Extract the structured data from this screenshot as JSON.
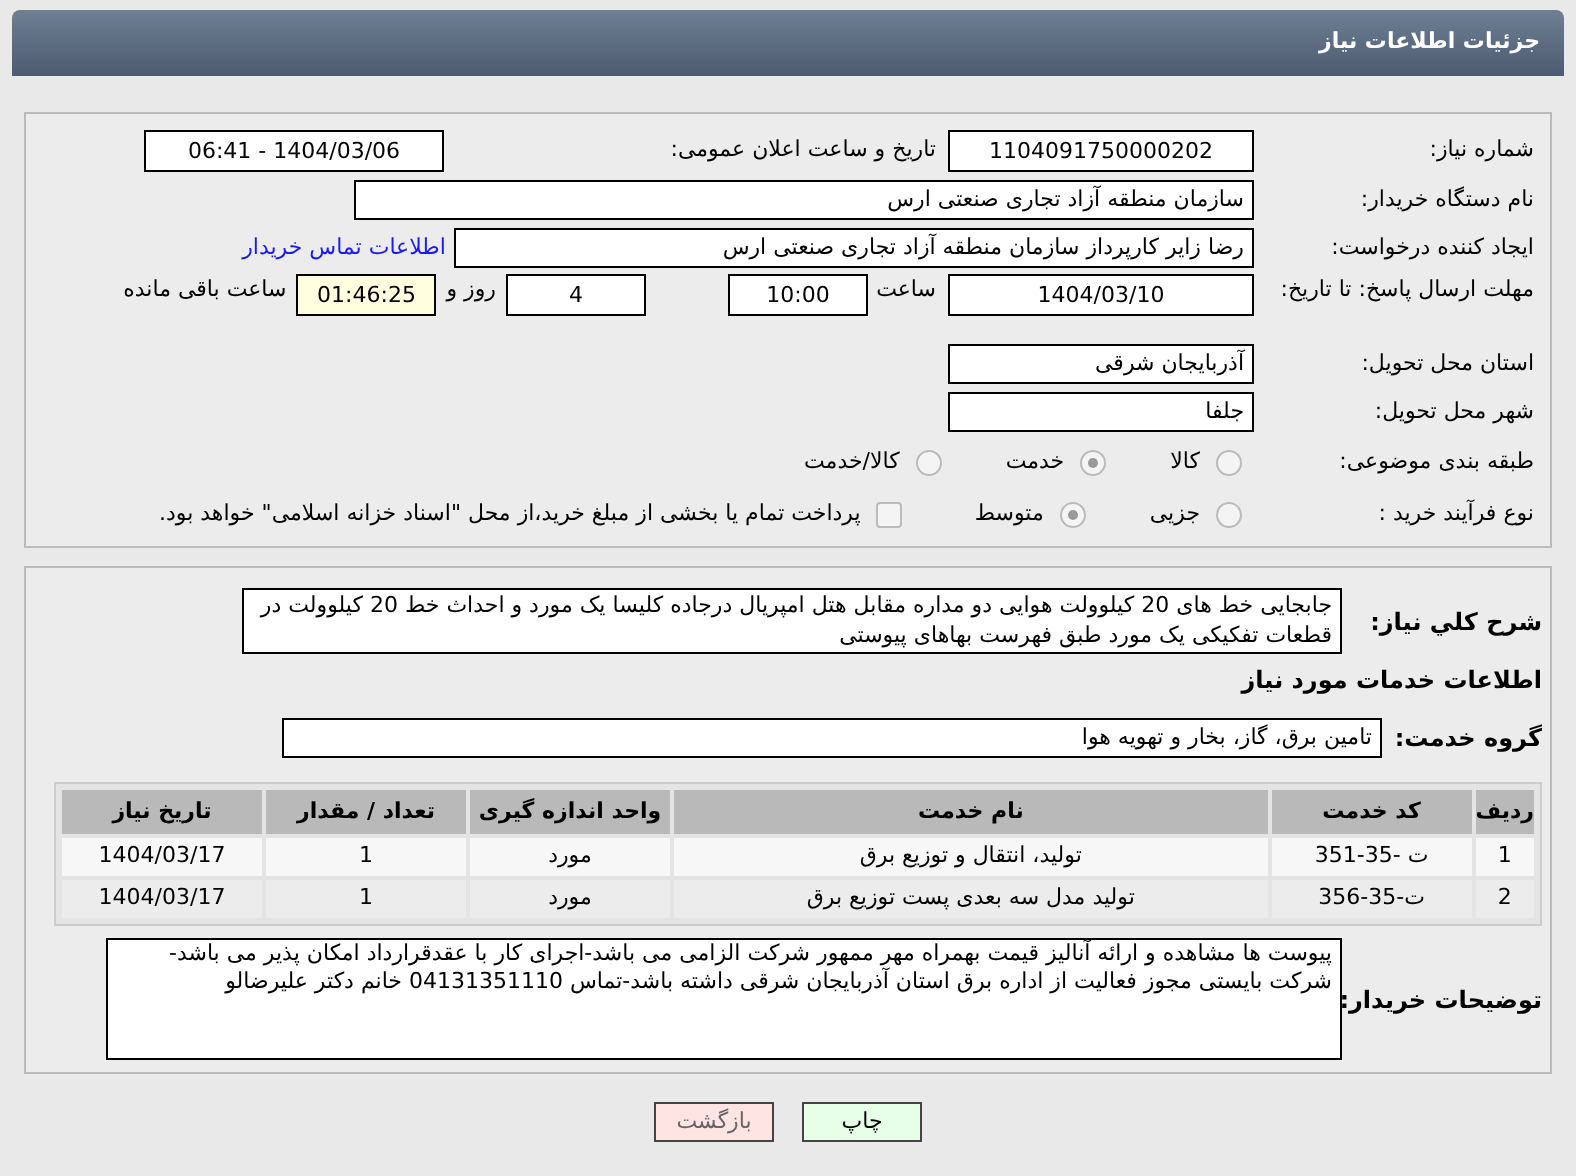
{
  "header": {
    "title": "جزئیات اطلاعات نیاز"
  },
  "request": {
    "need_number_label": "شماره نیاز:",
    "need_number": "1104091750000202",
    "announce_label": "تاریخ و ساعت اعلان عمومی:",
    "announce": "1404/03/06 - 06:41",
    "buyer_label": "نام دستگاه خریدار:",
    "buyer": "سازمان منطقه آزاد تجاری صنعتی ارس",
    "creator_label": "ایجاد کننده درخواست:",
    "creator": "رضا زایر کارپرداز سازمان منطقه آزاد تجاری صنعتی ارس",
    "contact_link": "اطلاعات تماس خریدار",
    "deadline_label": "مهلت ارسال پاسخ: تا تاریخ:",
    "deadline_date": "1404/03/10",
    "time_label": "ساعت",
    "deadline_time": "10:00",
    "days": "4",
    "days_label": "روز و",
    "remaining": "01:46:25",
    "remaining_label": "ساعت باقی مانده",
    "province_label": "استان محل تحویل:",
    "province": "آذربایجان شرقی",
    "city_label": "شهر محل تحویل:",
    "city": "جلفا",
    "category_label": "طبقه بندی موضوعی:",
    "category_options": [
      {
        "label": "کالا",
        "selected": false
      },
      {
        "label": "خدمت",
        "selected": true
      },
      {
        "label": "کالا/خدمت",
        "selected": false
      }
    ],
    "purchase_label": "نوع فرآیند خرید :",
    "purchase_options": [
      {
        "label": "جزیی",
        "selected": false
      },
      {
        "label": "متوسط",
        "selected": true
      }
    ],
    "payment_checked": false,
    "payment_text": "پرداخت تمام یا بخشی از مبلغ خرید،از محل \"اسناد خزانه اسلامی\" خواهد بود."
  },
  "details": {
    "description_label": "شرح کلي نياز:",
    "description": "جابجایی خط های 20 کیلوولت هوایی دو مداره مقابل هتل امپریال درجاده کلیسا یک مورد و احداث خط 20 کیلوولت در قطعات تفکیکی یک مورد طبق فهرست بهاهای پیوستی",
    "services_title": "اطلاعات خدمات مورد نیاز",
    "group_label": "گروه خدمت:",
    "group": "تامین برق، گاز، بخار و تهویه هوا",
    "table": {
      "columns": [
        "ردیف",
        "کد خدمت",
        "نام خدمت",
        "واحد اندازه گیری",
        "تعداد / مقدار",
        "تاریخ نیاز"
      ],
      "rows": [
        [
          "1",
          "ت -35-351",
          "تولید، انتقال و توزیع برق",
          "مورد",
          "1",
          "1404/03/17"
        ],
        [
          "2",
          "ت-35-356",
          "تولید مدل سه بعدی پست توزیع برق",
          "مورد",
          "1",
          "1404/03/17"
        ]
      ]
    },
    "notes_label": "توضیحات خریدار:",
    "notes": "پیوست ها مشاهده و ارائه آنالیز قیمت بهمراه مهر ممهور شرکت الزامی می باشد-اجرای کار با عقدقرارداد امکان پذیر می باشد-شرکت بایستی مجوز فعالیت از اداره برق استان آذربایجان شرقی داشته باشد-تماس 04131351110 خانم دکتر علیرضالو"
  },
  "buttons": [
    {
      "label": "چاپ",
      "kind": "print"
    },
    {
      "label": "بازگشت",
      "kind": "back"
    }
  ]
}
